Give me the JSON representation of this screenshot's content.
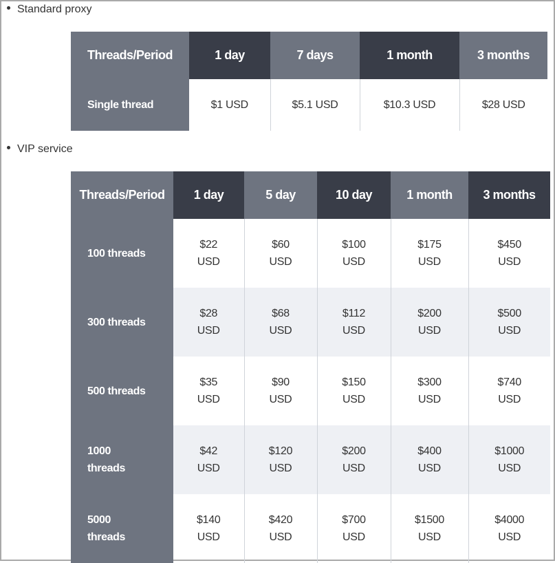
{
  "sections": [
    {
      "title": "Standard proxy",
      "headers": [
        "Threads/Period",
        "1 day",
        "7 days",
        "1 month",
        "3 months"
      ],
      "rows": [
        {
          "label": "Single thread",
          "values": [
            "$1 USD",
            "$5.1 USD",
            "$10.3 USD",
            "$28 USD"
          ]
        }
      ]
    },
    {
      "title": "VIP service",
      "headers": [
        "Threads/Period",
        "1 day",
        "5 day",
        "10 day",
        "1 month",
        "3 months"
      ],
      "rows": [
        {
          "label": "100 threads",
          "values": [
            [
              "$22",
              "USD"
            ],
            [
              "$60",
              "USD"
            ],
            [
              "$100",
              "USD"
            ],
            [
              "$175",
              "USD"
            ],
            [
              "$450",
              "USD"
            ]
          ]
        },
        {
          "label": "300 threads",
          "values": [
            [
              "$28",
              "USD"
            ],
            [
              "$68",
              "USD"
            ],
            [
              "$112",
              "USD"
            ],
            [
              "$200",
              "USD"
            ],
            [
              "$500",
              "USD"
            ]
          ]
        },
        {
          "label": "500 threads",
          "values": [
            [
              "$35",
              "USD"
            ],
            [
              "$90",
              "USD"
            ],
            [
              "$150",
              "USD"
            ],
            [
              "$300",
              "USD"
            ],
            [
              "$740",
              "USD"
            ]
          ]
        },
        {
          "label": [
            "1000",
            "threads"
          ],
          "values": [
            [
              "$42",
              "USD"
            ],
            [
              "$120",
              "USD"
            ],
            [
              "$200",
              "USD"
            ],
            [
              "$400",
              "USD"
            ],
            [
              "$1000",
              "USD"
            ]
          ]
        },
        {
          "label": [
            "5000",
            "threads"
          ],
          "values": [
            [
              "$140",
              "USD"
            ],
            [
              "$420",
              "USD"
            ],
            [
              "$700",
              "USD"
            ],
            [
              "$1500",
              "USD"
            ],
            [
              "$4000",
              "USD"
            ]
          ]
        }
      ]
    }
  ]
}
